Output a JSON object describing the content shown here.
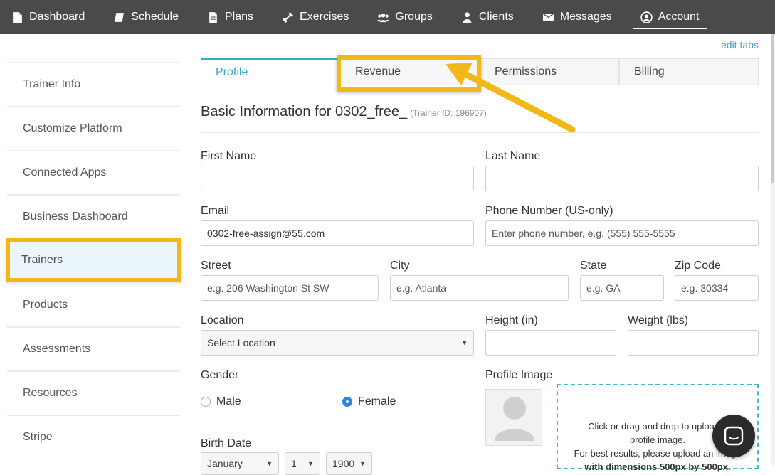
{
  "nav": {
    "items": [
      {
        "label": "Dashboard",
        "icon": "document-icon"
      },
      {
        "label": "Schedule",
        "icon": "book-icon"
      },
      {
        "label": "Plans",
        "icon": "file-icon"
      },
      {
        "label": "Exercises",
        "icon": "dumbbell-icon"
      },
      {
        "label": "Groups",
        "icon": "users-icon"
      },
      {
        "label": "Clients",
        "icon": "user-icon"
      },
      {
        "label": "Messages",
        "icon": "envelope-icon"
      },
      {
        "label": "Account",
        "icon": "account-circle-icon"
      }
    ],
    "active": "Account"
  },
  "sidebar": {
    "items": [
      {
        "label": "Trainer Info"
      },
      {
        "label": "Customize Platform"
      },
      {
        "label": "Connected Apps"
      },
      {
        "label": "Business Dashboard"
      },
      {
        "label": "Trainers"
      },
      {
        "label": "Products"
      },
      {
        "label": "Assessments"
      },
      {
        "label": "Resources"
      },
      {
        "label": "Stripe"
      }
    ],
    "selected": "Trainers"
  },
  "main": {
    "edit_tabs": "edit tabs",
    "tabs": [
      {
        "label": "Profile"
      },
      {
        "label": "Revenue"
      },
      {
        "label": "Permissions"
      },
      {
        "label": "Billing"
      }
    ],
    "title": "Basic Information for 0302_free_",
    "trainer_id": "(Trainer ID: 196907)",
    "form": {
      "first_name_label": "First Name",
      "last_name_label": "Last Name",
      "email_label": "Email",
      "email_value": "0302-free-assign@55.com",
      "phone_label": "Phone Number (US-only)",
      "phone_placeholder": "Enter phone number, e.g. (555) 555-5555",
      "street_label": "Street",
      "street_placeholder": "e.g. 206 Washington St SW",
      "city_label": "City",
      "city_placeholder": "e.g. Atlanta",
      "state_label": "State",
      "state_placeholder": "e.g. GA",
      "zip_label": "Zip Code",
      "zip_placeholder": "e.g. 30334",
      "location_label": "Location",
      "location_value": "Select Location",
      "height_label": "Height (in)",
      "weight_label": "Weight (lbs)",
      "gender_label": "Gender",
      "gender_male": "Male",
      "gender_female": "Female",
      "gender_selected": "Female",
      "profile_image_label": "Profile Image",
      "dropzone_line1": "Click or drag and drop to upload a",
      "dropzone_line2": "profile image.",
      "dropzone_line3": "For best results, please upload an image",
      "dropzone_line4": "with dimensions 500px by 500px.",
      "birth_date_label": "Birth Date",
      "birth_month": "January",
      "birth_day": "1",
      "birth_year": "1900"
    }
  },
  "colors": {
    "nav_bg": "#4a4a4a",
    "accent": "#3aa6c7",
    "highlight": "#f2b817",
    "radio_selected": "#2f86d6"
  }
}
